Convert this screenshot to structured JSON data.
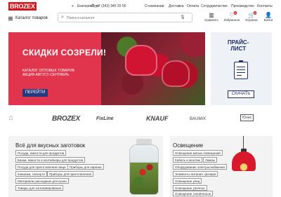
{
  "header": {
    "logo": "BROZEX",
    "city": "Екатеринбург",
    "phone": "+7 (343) 345 20 00",
    "links": [
      "О компании",
      "Доставка",
      "Оплата",
      "Сотрудничество",
      "Производство",
      "Контакты"
    ]
  },
  "nav": {
    "catalog_label": "Каталог товаров",
    "search_placeholder": "Поиск в каталоге",
    "actions": [
      {
        "label": "Сравнить",
        "icon": "compare-icon",
        "badge": ""
      },
      {
        "label": "Избранное",
        "icon": "heart-icon",
        "badge": "0"
      },
      {
        "label": "Корзина",
        "icon": "cart-icon",
        "badge": "0"
      },
      {
        "label": "Войти",
        "icon": "user-icon",
        "badge": ""
      }
    ]
  },
  "hero": {
    "title": "СКИДКИ СОЗРЕЛИ!",
    "subtitle_line1": "КАТАЛОГ ОПТОВЫХ ТОВАРОВ",
    "subtitle_line2": "АКЦИЯ АВГУСТ-СЕНТЯБРЬ",
    "button": "ПЕРЕЙТИ",
    "color": "#e0354c"
  },
  "price_banner": {
    "title_line1": "ПРАЙС-",
    "title_line2": "ЛИСТ",
    "button": "СКАЧАТЬ"
  },
  "brands": [
    "BROZEX",
    "FixLine",
    "KNAUF",
    "BAUMIX",
    "Юнис"
  ],
  "categories": [
    {
      "title": "Всё для вкусных заготовок",
      "tags": [
        "Посуда, емкости для продуктов",
        "Банки, емкости и контейнеры для продуктов",
        "Посуда для приготовления пищи",
        "Приборы для нарезки",
        "Ковшики, скатерти",
        "Приборы для приготовления",
        "Материалы расходные для кухни",
        "Товары для консервирования"
      ]
    },
    {
      "title": "Освещение",
      "tags": [
        "Освещение жилых помещений",
        "Кабель и монтаж",
        "Лампы",
        "Оборудование электроснабжения",
        "Элементы питания, фонари",
        "Освещение улиц",
        "Освещение уличное",
        "Освещение техническое"
      ]
    }
  ]
}
